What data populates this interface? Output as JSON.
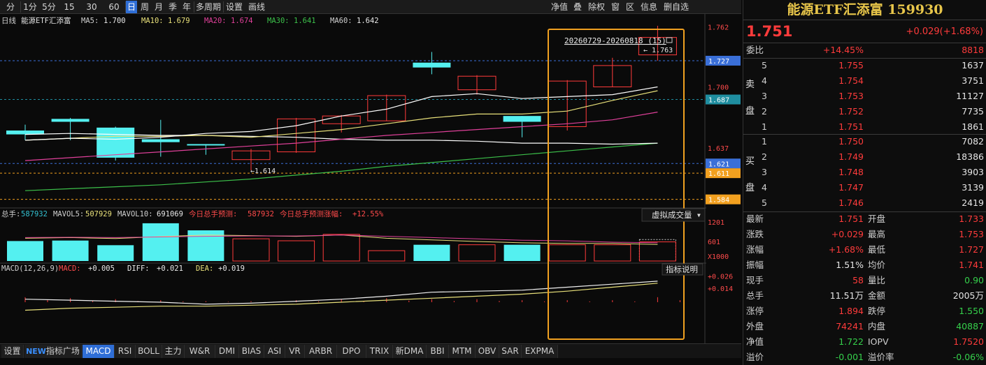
{
  "toolbar": {
    "periods": [
      "分时",
      "1分",
      "5分",
      "15分",
      "30分",
      "60分",
      "日",
      "周",
      "月",
      "季",
      "年",
      "多周期",
      "设置",
      "画线"
    ],
    "active_period": "日",
    "right_buttons": [
      "净值",
      "叠",
      "除权",
      "窗",
      "区",
      "信息",
      "删自选"
    ]
  },
  "info_line": {
    "prefix": "日线",
    "name": "能源ETF汇添富",
    "ma5_label": "MA5:",
    "ma5": "1.700",
    "ma10_label": "MA10:",
    "ma10": "1.679",
    "ma20_label": "MA20:",
    "ma20": "1.674",
    "ma30_label": "MA30:",
    "ma30": "1.641",
    "ma60_label": "MA60:",
    "ma60": "1.642"
  },
  "price_axis": {
    "ticks": [
      "1.762",
      "1.700",
      "1.637"
    ],
    "badges": [
      {
        "label": "1.727",
        "color": "#3a6fd8"
      },
      {
        "label": "1.687",
        "color": "#1f8ea0"
      },
      {
        "label": "1.621",
        "color": "#3a6fd8"
      },
      {
        "label": "1.611",
        "color": "#f2a01f"
      },
      {
        "label": "1.584",
        "color": "#f2a01f"
      }
    ]
  },
  "annotations": {
    "range_label": "20260729-20260818 (15)",
    "high_mark": "1.763",
    "low_mark": "1.614"
  },
  "volume": {
    "line": [
      {
        "t": "总手:",
        "c": "#d0d0d0"
      },
      {
        "t": "587932",
        "c": "#33c0d0"
      },
      {
        "t": "MAVOL5:",
        "c": "#d0d0d0"
      },
      {
        "t": "507929",
        "c": "#e8e07a"
      },
      {
        "t": "MAVOL10:",
        "c": "#d0d0d0"
      },
      {
        "t": "691069",
        "c": "#e8e8e8"
      },
      {
        "t": "今日总手预测:",
        "c": "#ff4b4b"
      },
      {
        "t": "587932",
        "c": "#ff4b4b"
      },
      {
        "t": "今日总手预测涨幅:",
        "c": "#ff4b4b"
      },
      {
        "t": "+12.55%",
        "c": "#ff4b4b"
      }
    ],
    "dropdown": "虚拟成交量",
    "ticks": [
      "1201",
      "601",
      "X1000"
    ]
  },
  "macd": {
    "line": [
      {
        "t": "MACD(12,26,9)",
        "c": "#d0d0d0"
      },
      {
        "t": "MACD:",
        "c": "#ff4b4b"
      },
      {
        "t": "+0.005",
        "c": "#e8e8e8"
      },
      {
        "t": "DIFF:",
        "c": "#e8e8e8"
      },
      {
        "t": "+0.021",
        "c": "#e8e8e8"
      },
      {
        "t": "DEA:",
        "c": "#e8e07a"
      },
      {
        "t": "+0.019",
        "c": "#e8e8e8"
      }
    ],
    "help": "指标说明",
    "ticks": [
      "+0.026",
      "+0.014"
    ]
  },
  "chart_data": {
    "type": "candlestick",
    "price_range": [
      1.578,
      1.768
    ],
    "candles": [
      {
        "o": 1.655,
        "c": 1.651,
        "h": 1.661,
        "l": 1.645
      },
      {
        "o": 1.667,
        "c": 1.664,
        "h": 1.668,
        "l": 1.645
      },
      {
        "o": 1.658,
        "c": 1.627,
        "h": 1.659,
        "l": 1.624
      },
      {
        "o": 1.646,
        "c": 1.643,
        "h": 1.666,
        "l": 1.628
      },
      {
        "o": 1.641,
        "c": 1.64,
        "h": 1.641,
        "l": 1.63
      },
      {
        "o": 1.625,
        "c": 1.634,
        "h": 1.636,
        "l": 1.614
      },
      {
        "o": 1.633,
        "c": 1.667,
        "h": 1.668,
        "l": 1.632
      },
      {
        "o": 1.662,
        "c": 1.67,
        "h": 1.671,
        "l": 1.653
      },
      {
        "o": 1.665,
        "c": 1.691,
        "h": 1.692,
        "l": 1.665
      },
      {
        "o": 1.725,
        "c": 1.72,
        "h": 1.736,
        "l": 1.713
      },
      {
        "o": 1.697,
        "c": 1.711,
        "h": 1.712,
        "l": 1.692
      },
      {
        "o": 1.67,
        "c": 1.664,
        "h": 1.67,
        "l": 1.648
      },
      {
        "o": 1.659,
        "c": 1.706,
        "h": 1.707,
        "l": 1.655
      },
      {
        "o": 1.7,
        "c": 1.722,
        "h": 1.73,
        "l": 1.7
      },
      {
        "o": 1.733,
        "c": 1.751,
        "h": 1.763,
        "l": 1.727
      }
    ],
    "ma5": [
      1.645,
      1.647,
      1.646,
      1.648,
      1.652,
      1.654,
      1.66,
      1.67,
      1.677,
      1.69,
      1.693,
      1.688,
      1.69,
      1.692,
      1.7
    ],
    "ma10": [
      1.645,
      1.647,
      1.649,
      1.649,
      1.65,
      1.648,
      1.652,
      1.656,
      1.662,
      1.668,
      1.672,
      1.672,
      1.675,
      1.686,
      1.696
    ],
    "ma20": [
      1.624,
      1.627,
      1.63,
      1.633,
      1.636,
      1.639,
      1.642,
      1.646,
      1.65,
      1.653,
      1.656,
      1.659,
      1.662,
      1.666,
      1.674
    ],
    "ma30": [
      1.651,
      1.652,
      1.651,
      1.65,
      1.65,
      1.649,
      1.648,
      1.646,
      1.645,
      1.645,
      1.644,
      1.642,
      1.642,
      1.641,
      1.642
    ],
    "ma60": [
      1.593,
      1.595,
      1.597,
      1.599,
      1.602,
      1.605,
      1.609,
      1.613,
      1.618,
      1.622,
      1.626,
      1.63,
      1.634,
      1.638,
      1.642
    ],
    "volume_range": [
      0,
      1201
    ],
    "volume": [
      614,
      629,
      486,
      1160,
      943,
      683,
      622,
      820,
      318,
      500,
      500,
      500,
      500,
      500,
      588
    ],
    "mavol5": [
      700,
      720,
      690,
      750,
      800,
      780,
      760,
      800,
      700,
      650,
      600,
      560,
      540,
      540,
      508
    ],
    "mavol10": [
      720,
      730,
      720,
      740,
      760,
      770,
      770,
      800,
      760,
      720,
      680,
      640,
      620,
      580,
      560
    ],
    "macd_range": [
      -0.03,
      0.03
    ],
    "diff": [
      0.003,
      0.002,
      0.001,
      0.0,
      -0.002,
      -0.001,
      0.001,
      0.003,
      0.006,
      0.01,
      0.011,
      0.012,
      0.015,
      0.018,
      0.021
    ],
    "dea": [
      -0.008,
      -0.006,
      -0.005,
      -0.004,
      -0.004,
      -0.003,
      -0.002,
      0.0,
      0.002,
      0.004,
      0.006,
      0.008,
      0.011,
      0.015,
      0.019
    ],
    "macd": [
      0.005,
      0.004,
      0.003,
      0.002,
      0.001,
      0.001,
      0.002,
      0.003,
      0.004,
      0.003,
      0.003,
      0.002,
      0.002,
      0.002,
      0.005
    ]
  },
  "quote": {
    "title": "能源ETF汇添富 159930",
    "price": "1.751",
    "change": "+0.029(+1.68%)",
    "webi_label": "委比",
    "webi": "+14.45%",
    "weicha": "8818",
    "sell_side": [
      "卖",
      "盘"
    ],
    "buy_side": [
      "买",
      "盘"
    ],
    "asks": [
      {
        "lvl": "5",
        "p": "1.755",
        "v": "1637"
      },
      {
        "lvl": "4",
        "p": "1.754",
        "v": "3751"
      },
      {
        "lvl": "3",
        "p": "1.753",
        "v": "11127"
      },
      {
        "lvl": "2",
        "p": "1.752",
        "v": "7735"
      },
      {
        "lvl": "1",
        "p": "1.751",
        "v": "1861"
      }
    ],
    "bids": [
      {
        "lvl": "1",
        "p": "1.750",
        "v": "7082"
      },
      {
        "lvl": "2",
        "p": "1.749",
        "v": "18386"
      },
      {
        "lvl": "3",
        "p": "1.748",
        "v": "3903"
      },
      {
        "lvl": "4",
        "p": "1.747",
        "v": "3139"
      },
      {
        "lvl": "5",
        "p": "1.746",
        "v": "2419"
      }
    ],
    "stats": [
      {
        "l1": "最新",
        "v1": "1.751",
        "c1": "up",
        "l2": "开盘",
        "v2": "1.733",
        "c2": "up"
      },
      {
        "l1": "涨跌",
        "v1": "+0.029",
        "c1": "up",
        "l2": "最高",
        "v2": "1.753",
        "c2": "up"
      },
      {
        "l1": "涨幅",
        "v1": "+1.68%",
        "c1": "up",
        "l2": "最低",
        "v2": "1.727",
        "c2": "up"
      },
      {
        "l1": "振幅",
        "v1": "1.51%",
        "c1": "wh",
        "l2": "均价",
        "v2": "1.741",
        "c2": "up"
      },
      {
        "l1": "现手",
        "v1": "58",
        "c1": "up",
        "l2": "量比",
        "v2": "0.90",
        "c2": "gn"
      },
      {
        "l1": "总手",
        "v1": "11.51万",
        "c1": "wh",
        "l2": "金额",
        "v2": "2005万",
        "c2": "wh"
      },
      {
        "l1": "涨停",
        "v1": "1.894",
        "c1": "up",
        "l2": "跌停",
        "v2": "1.550",
        "c2": "gn"
      },
      {
        "l1": "外盘",
        "v1": "74241",
        "c1": "up",
        "l2": "内盘",
        "v2": "40887",
        "c2": "gn"
      },
      {
        "l1": "净值",
        "v1": "1.722",
        "c1": "gn",
        "l2": "IOPV",
        "v2": "1.7520",
        "c2": "up"
      },
      {
        "l1": "溢价",
        "v1": "-0.001",
        "c1": "gn",
        "l2": "溢价率",
        "v2": "-0.06%",
        "c2": "gn"
      }
    ]
  },
  "indicators": {
    "settings": "设置",
    "plaza_new": "NEW",
    "plaza": "指标广场",
    "tabs": [
      "MACD",
      "RSI",
      "BOLL",
      "主力",
      "W&R",
      "DMI",
      "BIAS",
      "ASI",
      "VR",
      "ARBR",
      "DPO",
      "TRIX",
      "新DMA",
      "BBI",
      "MTM",
      "OBV",
      "SAR",
      "EXPMA"
    ],
    "active": "MACD"
  },
  "colors": {
    "up": "#ff3b3b",
    "down": "#54f0f0",
    "ma5": "#ffffff",
    "ma10": "#e8e07a",
    "ma20": "#e0409a",
    "ma30": "#ffffff",
    "ma60": "#3cc04a",
    "highlight": "#f0a020"
  }
}
